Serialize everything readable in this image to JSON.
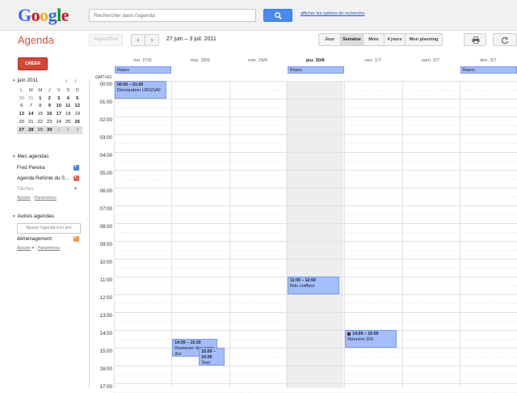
{
  "header": {
    "logo_letters": [
      {
        "ch": "G",
        "color": "#3369e8"
      },
      {
        "ch": "o",
        "color": "#d50f25"
      },
      {
        "ch": "o",
        "color": "#eeb211"
      },
      {
        "ch": "g",
        "color": "#3369e8"
      },
      {
        "ch": "l",
        "color": "#009925"
      },
      {
        "ch": "e",
        "color": "#d50f25"
      }
    ],
    "search_placeholder": "Rechercher dans l'agenda",
    "search_options_link": "afficher les options de recherche"
  },
  "toolbar": {
    "app_name": "Agenda",
    "today_label": "Aujourd'hui",
    "prev_icon": "‹",
    "next_icon": "›",
    "date_range": "27 juin – 3 juil. 2011",
    "views": [
      {
        "label": "Jour",
        "selected": false
      },
      {
        "label": "Semaine",
        "selected": true
      },
      {
        "label": "Mois",
        "selected": false
      },
      {
        "label": "4 jours",
        "selected": false
      },
      {
        "label": "Mon planning",
        "selected": false
      }
    ],
    "print_icon": "printer-icon",
    "refresh_icon": "refresh-icon"
  },
  "sidebar": {
    "create_label": "CRÉER",
    "mini_calendar": {
      "title": "juin 2011",
      "prev": "‹",
      "next": "›",
      "weekdays": [
        "L",
        "M",
        "M",
        "J",
        "V",
        "S",
        "D"
      ],
      "weeks": [
        [
          {
            "d": "30",
            "o": true
          },
          {
            "d": "31",
            "o": true
          },
          {
            "d": "1",
            "b": true
          },
          {
            "d": "2",
            "b": true
          },
          {
            "d": "3",
            "b": true
          },
          {
            "d": "4",
            "b": true
          },
          {
            "d": "5",
            "b": true
          }
        ],
        [
          {
            "d": "6"
          },
          {
            "d": "7"
          },
          {
            "d": "8"
          },
          {
            "d": "9",
            "b": true
          },
          {
            "d": "10",
            "b": true
          },
          {
            "d": "11",
            "b": true
          },
          {
            "d": "12",
            "b": true
          }
        ],
        [
          {
            "d": "13",
            "b": true
          },
          {
            "d": "14",
            "b": true
          },
          {
            "d": "15"
          },
          {
            "d": "16",
            "b": true
          },
          {
            "d": "17",
            "b": true
          },
          {
            "d": "18"
          },
          {
            "d": "19"
          }
        ],
        [
          {
            "d": "20"
          },
          {
            "d": "21"
          },
          {
            "d": "22"
          },
          {
            "d": "23"
          },
          {
            "d": "24"
          },
          {
            "d": "25"
          },
          {
            "d": "26",
            "b": true
          }
        ],
        [
          {
            "d": "27",
            "b": true
          },
          {
            "d": "28",
            "b": true
          },
          {
            "d": "29"
          },
          {
            "d": "30",
            "b": true
          },
          {
            "d": "1",
            "o": true
          },
          {
            "d": "2",
            "o": true
          },
          {
            "d": "3",
            "o": true
          }
        ]
      ],
      "current_week_index": 4
    },
    "my_calendars": {
      "title": "Mes agendas",
      "items": [
        {
          "label": "Fred Pereira",
          "color": "#4986e7"
        },
        {
          "label": "Agenda Refonte du S...",
          "color": "#e66550"
        }
      ],
      "tasks_label": "Tâches",
      "tasks_dropdown": "▾",
      "add_link": "Ajouter",
      "settings_link": "Paramètres"
    },
    "other_calendars": {
      "title": "Autres agendas",
      "friend_placeholder": "Ajouter l'agenda d'un ami",
      "items": [
        {
          "label": "déménagement",
          "color": "#f09b49"
        }
      ],
      "add_link": "Ajouter",
      "add_dropdown": "▾",
      "settings_link": "Paramètres"
    }
  },
  "week": {
    "timezone": "GMT+01",
    "days": [
      {
        "label": "lun. 27/6",
        "today": false
      },
      {
        "label": "mar. 28/6",
        "today": false
      },
      {
        "label": "mer. 29/6",
        "today": false
      },
      {
        "label": "jeu. 30/6",
        "today": true
      },
      {
        "label": "ven. 1/7",
        "today": false
      },
      {
        "label": "sam. 2/7",
        "today": false
      },
      {
        "label": "dim. 3/7",
        "today": false
      }
    ],
    "all_day_events": [
      {
        "day": 0,
        "title": "Repos"
      },
      {
        "day": 3,
        "title": "Repos"
      },
      {
        "day": 6,
        "title": "Repos"
      }
    ],
    "hours": [
      "00:00",
      "01:00",
      "02:00",
      "03:00",
      "04:00",
      "05:00",
      "06:00",
      "07:00",
      "08:00",
      "09:00",
      "10:00",
      "11:00",
      "12:00",
      "13:00",
      "14:00",
      "15:00",
      "16:00",
      "17:00"
    ],
    "events": [
      {
        "day": 0,
        "start": 0.0,
        "end": 1.0,
        "time": "00:00 – 01:00",
        "title": "Déclaration URSSAF",
        "icon": false
      },
      {
        "day": 3,
        "start": 11.0,
        "end": 12.0,
        "time": "11:00 – 12:00",
        "title": "Rdv coiffeur",
        "icon": false
      },
      {
        "day": 4,
        "start": 14.0,
        "end": 15.0,
        "time": "14:00 – 15:00",
        "title": "Réunion DG",
        "icon": true
      },
      {
        "day": 1,
        "start": 14.5,
        "end": 15.5,
        "time": "14:30 – 15:30",
        "title": "Ramener des tapis dur",
        "icon": false
      },
      {
        "day": 1,
        "start": 15.0,
        "end": 16.0,
        "time": "15:00 – 16:00",
        "title": "Test",
        "icon": false
      }
    ]
  }
}
